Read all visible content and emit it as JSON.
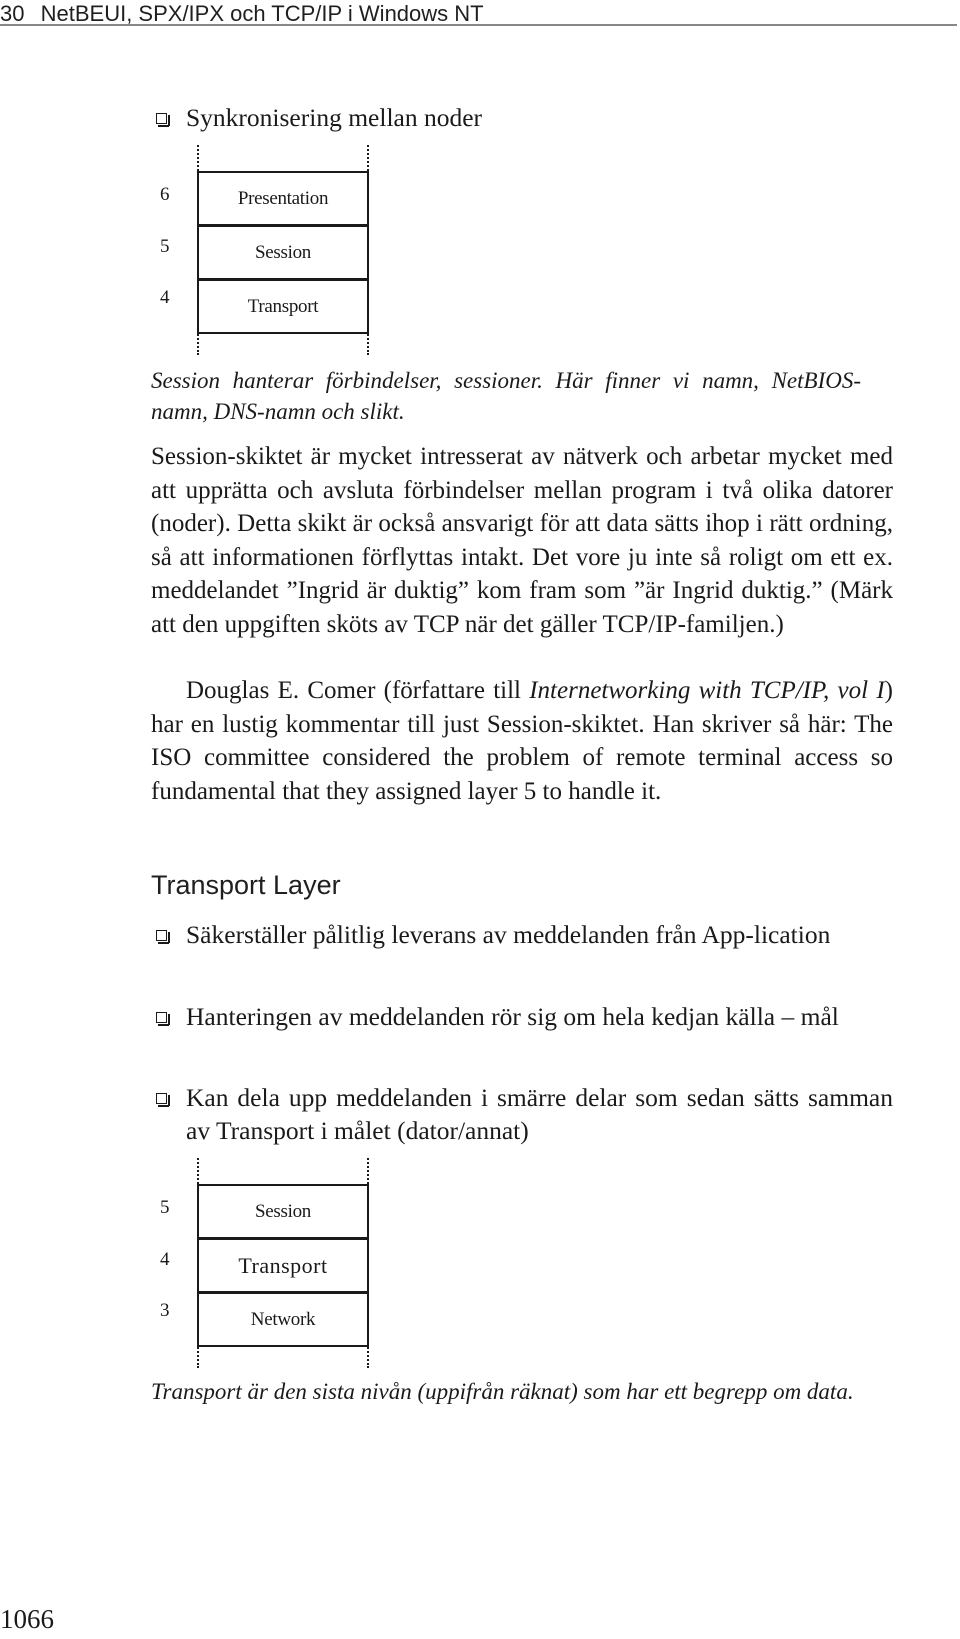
{
  "running_head": {
    "chapter_number": "30",
    "title": "NetBEUI, SPX/IPX och TCP/IP i Windows NT"
  },
  "session_section": {
    "bullet": "Synkronisering mellan noder",
    "diagram": {
      "layers": [
        {
          "number": "6",
          "name": "Presentation"
        },
        {
          "number": "5",
          "name": "Session"
        },
        {
          "number": "4",
          "name": "Transport"
        }
      ]
    },
    "caption": "Session hanterar förbindelser, sessioner. Här finner vi namn, NetBIOS-namn, DNS-namn och slikt.",
    "paragraph1": "Session-skiktet är mycket intresserat av nätverk och arbetar mycket med att upprätta och avsluta förbindelser mellan program i två olika datorer (noder). Detta skikt är också ansvarigt för att data sätts ihop i rätt ordning, så att informationen förflyttas intakt. Det vore ju inte så roligt om ett ex. meddelandet ”Ingrid är duktig” kom fram som ”är Ingrid duktig.” (Märk att den uppgiften sköts av TCP när det gäller TCP/IP-familjen.)",
    "paragraph2": {
      "before": "Douglas E. Comer (författare till ",
      "book_title": "Internetworking with TCP/IP, vol I",
      "after": ") har en lustig kommentar till just Session-skiktet. Han skriver så här: The ISO committee considered the problem of remote terminal access so fundamental that they assigned layer 5 to handle it."
    }
  },
  "transport_section": {
    "heading": "Transport Layer",
    "bullets": [
      "Säkerställer pålitlig leverans av meddelanden från App-lication",
      "Hanteringen av meddelanden rör sig om hela kedjan källa – mål",
      "Kan dela upp meddelanden i smärre delar som sedan sätts samman av Transport i målet (dator/annat)"
    ],
    "diagram": {
      "layers": [
        {
          "number": "5",
          "name": "Session"
        },
        {
          "number": "4",
          "name": "Transport"
        },
        {
          "number": "3",
          "name": "Network"
        }
      ]
    },
    "caption": "Transport är den sista nivån (uppifrån räknat) som har ett begrepp om data."
  },
  "folio": "1066"
}
